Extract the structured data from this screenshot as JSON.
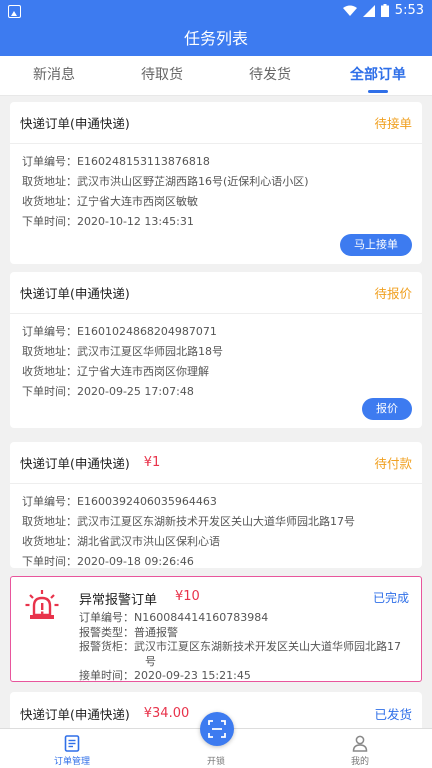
{
  "status_bar": {
    "time": "5:53"
  },
  "header": {
    "title": "任务列表"
  },
  "tabs": [
    {
      "label": "新消息"
    },
    {
      "label": "待取货"
    },
    {
      "label": "待发货"
    },
    {
      "label": "全部订单"
    }
  ],
  "orders": [
    {
      "title": "快递订单(申通快递)",
      "price": "",
      "status": "待接单",
      "order_no": "订单编号：E160248153113876818",
      "pickup": "取货地址：武汉市洪山区野芷湖西路16号(近保利心语小区)",
      "delivery": "收货地址：辽宁省大连市西岗区敏敏",
      "time": "下单时间：2020-10-12 13:45:31",
      "button": "马上接单"
    },
    {
      "title": "快递订单(申通快递)",
      "price": "",
      "status": "待报价",
      "order_no": "订单编号：E1601024868204987071",
      "pickup": "取货地址：武汉市江夏区华师园北路18号",
      "delivery": "收货地址：辽宁省大连市西岗区你理解",
      "time": "下单时间：2020-09-25 17:07:48",
      "button": "报价"
    },
    {
      "title": "快递订单(申通快递)",
      "price": "¥1",
      "status": "待付款",
      "order_no": "订单编号：E1600392406035964463",
      "pickup": "取货地址：武汉市江夏区东湖新技术开发区关山大道华师园北路17号",
      "delivery": "收货地址：湖北省武汉市洪山区保利心语",
      "time": "下单时间：2020-09-18 09:26:46"
    }
  ],
  "alarm_order": {
    "title": "异常报警订单",
    "price": "¥10",
    "status": "已完成",
    "order_no": "订单编号：N160084414160783984",
    "alarm_type": "报警类型：普通报警",
    "cabinet_line1": "报警货柜：武汉市江夏区东湖新技术开发区关山大道华师园北路17",
    "cabinet_line2": "号",
    "time": "接单时间：2020-09-23 15:21:45"
  },
  "partial_order": {
    "title": "快递订单(申通快递)",
    "price": "¥34.00",
    "status": "已发货"
  },
  "bottom_nav": {
    "orders": "订单管理",
    "unlock": "开锁",
    "mine": "我的"
  },
  "colors": {
    "primary": "#3d7bf0",
    "pending": "#f0a020",
    "price": "#e8334b",
    "alarm_border": "#e8559c"
  }
}
